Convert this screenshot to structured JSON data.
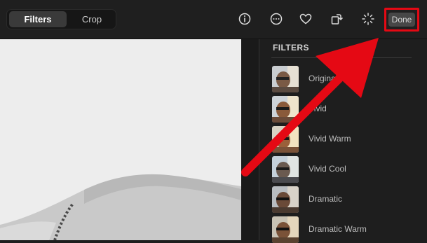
{
  "toolbar": {
    "tabs": [
      {
        "label": "Filters",
        "active": true
      },
      {
        "label": "Crop",
        "active": false
      }
    ],
    "icons": [
      "info-icon",
      "more-icon",
      "heart-icon",
      "rotate-icon",
      "magic-wand-icon"
    ],
    "done_label": "Done"
  },
  "sidebar": {
    "title": "FILTERS",
    "filters": [
      {
        "label": "Original",
        "tint": "#8a6a52"
      },
      {
        "label": "Vivid",
        "tint": "#9a6d4a"
      },
      {
        "label": "Vivid Warm",
        "tint": "#a8764a"
      },
      {
        "label": "Vivid Cool",
        "tint": "#6d7f8f"
      },
      {
        "label": "Dramatic",
        "tint": "#7a5a48"
      },
      {
        "label": "Dramatic Warm",
        "tint": "#9a7a5a"
      }
    ]
  },
  "colors": {
    "annotation_red": "#e50914",
    "background": "#1e1e1e"
  }
}
